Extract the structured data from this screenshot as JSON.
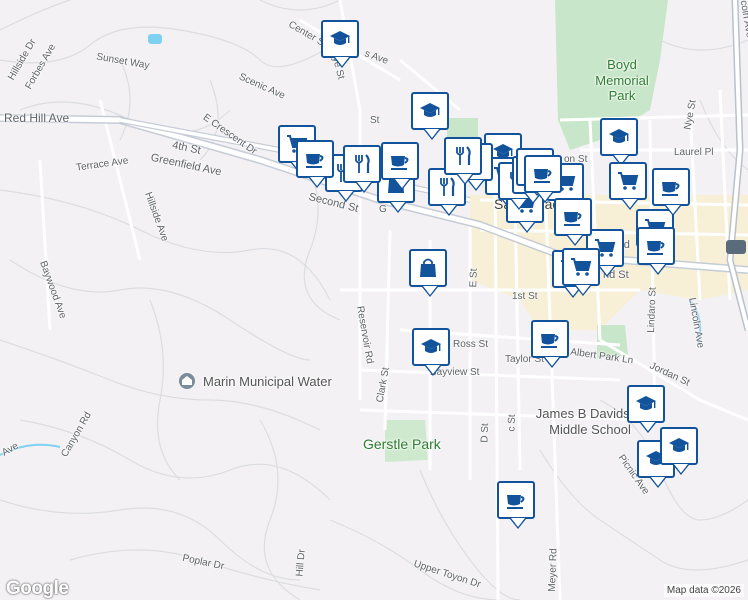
{
  "map": {
    "streets": [
      {
        "id": "red-hill-ave",
        "text": "Red Hill Ave"
      },
      {
        "id": "fourth-st",
        "text": "4th St"
      },
      {
        "id": "greenfield-ave",
        "text": "Greenfield Ave"
      },
      {
        "id": "e-crescent-dr",
        "text": "E Crescent Dr"
      },
      {
        "id": "terrace-ave",
        "text": "Terrace Ave"
      },
      {
        "id": "second-st",
        "text": "Second St"
      },
      {
        "id": "sunset-way",
        "text": "Sunset Way"
      },
      {
        "id": "scenic-ave",
        "text": "Scenic Ave"
      },
      {
        "id": "center-st",
        "text": "Center St"
      },
      {
        "id": "eye-st",
        "text": "Eye St"
      },
      {
        "id": "s-ave",
        "text": "s Ave"
      },
      {
        "id": "forbes-ave",
        "text": "Forbes Ave"
      },
      {
        "id": "hillside-dr",
        "text": "Hillside Dr"
      },
      {
        "id": "hillside-ave",
        "text": "Hillside Ave"
      },
      {
        "id": "baywood-ave",
        "text": "Baywood Ave"
      },
      {
        "id": "canyon-rd",
        "text": "Canyon Rd"
      },
      {
        "id": "ave-left",
        "text": "Ave"
      },
      {
        "id": "reservoir-rd",
        "text": "Reservoir Rd"
      },
      {
        "id": "clark-st",
        "text": "Clark St"
      },
      {
        "id": "d-st",
        "text": "D St"
      },
      {
        "id": "c-st",
        "text": "c St"
      },
      {
        "id": "e-st",
        "text": "E St"
      },
      {
        "id": "first-st",
        "text": "1st St"
      },
      {
        "id": "ross-st",
        "text": "Ross St"
      },
      {
        "id": "taylor-st",
        "text": "Taylor St"
      },
      {
        "id": "albert-park-ln",
        "text": "Albert Park Ln"
      },
      {
        "id": "bayview-st",
        "text": "Bayview St"
      },
      {
        "id": "jordan-st",
        "text": "Jordan St"
      },
      {
        "id": "lindaro-st",
        "text": "Lindaro St"
      },
      {
        "id": "lincoln-ave",
        "text": "Lincoln Ave"
      },
      {
        "id": "lincoln-ave-top",
        "text": "coln Ave"
      },
      {
        "id": "nye-st",
        "text": "Nye St"
      },
      {
        "id": "laurel-pl",
        "text": "Laurel Pl"
      },
      {
        "id": "third-st",
        "text": "3rd"
      },
      {
        "id": "second-st-east",
        "text": "nd St"
      },
      {
        "id": "picnic-ave",
        "text": "Picnic Ave"
      },
      {
        "id": "poplar-dr",
        "text": "Poplar Dr"
      },
      {
        "id": "upper-toyon-dr",
        "text": "Upper Toyon Dr"
      },
      {
        "id": "meyer-rd",
        "text": "Meyer Rd"
      },
      {
        "id": "hill-dr",
        "text": "Hill Dr"
      },
      {
        "id": "g-st",
        "text": "G"
      },
      {
        "id": "st-top",
        "text": "St"
      },
      {
        "id": "on-st",
        "text": "on St"
      }
    ],
    "places": [
      {
        "id": "boyd-park",
        "text": "Boyd Memorial Park"
      },
      {
        "id": "gerstle-park",
        "text": "Gerstle Park"
      },
      {
        "id": "san-rafael",
        "text": "San Rafael"
      },
      {
        "id": "marin-water",
        "text": "Marin Municipal Water"
      },
      {
        "id": "davidson-school",
        "text": "James B Davidson Middle School"
      }
    ],
    "attribution": {
      "logo": "Google",
      "copyright": "Map data ©2026"
    },
    "markers": [
      {
        "type": "school"
      },
      {
        "type": "school"
      },
      {
        "type": "school"
      },
      {
        "type": "school"
      },
      {
        "type": "school"
      },
      {
        "type": "school"
      },
      {
        "type": "school"
      },
      {
        "type": "school"
      },
      {
        "type": "shopping"
      },
      {
        "type": "shopping"
      },
      {
        "type": "shopping"
      },
      {
        "type": "shopping"
      },
      {
        "type": "shopping"
      },
      {
        "type": "shopping"
      },
      {
        "type": "shopping"
      },
      {
        "type": "shopping"
      },
      {
        "type": "shopping"
      },
      {
        "type": "store"
      },
      {
        "type": "store"
      },
      {
        "type": "store"
      },
      {
        "type": "restaurant"
      },
      {
        "type": "restaurant"
      },
      {
        "type": "restaurant"
      },
      {
        "type": "restaurant"
      },
      {
        "type": "restaurant"
      },
      {
        "type": "restaurant"
      },
      {
        "type": "cafe"
      },
      {
        "type": "cafe"
      },
      {
        "type": "cafe"
      },
      {
        "type": "cafe"
      },
      {
        "type": "cafe"
      },
      {
        "type": "cafe"
      },
      {
        "type": "cafe"
      },
      {
        "type": "cafe"
      },
      {
        "type": "cafe"
      }
    ],
    "colors": {
      "background": "#f3f1f4",
      "park": "#c8e6c9",
      "downtown": "#f7efd6",
      "road": "#ffffff",
      "highway_outline": "#b9c1cc",
      "water": "#7fd1f2",
      "marker_border": "#12539c"
    }
  }
}
